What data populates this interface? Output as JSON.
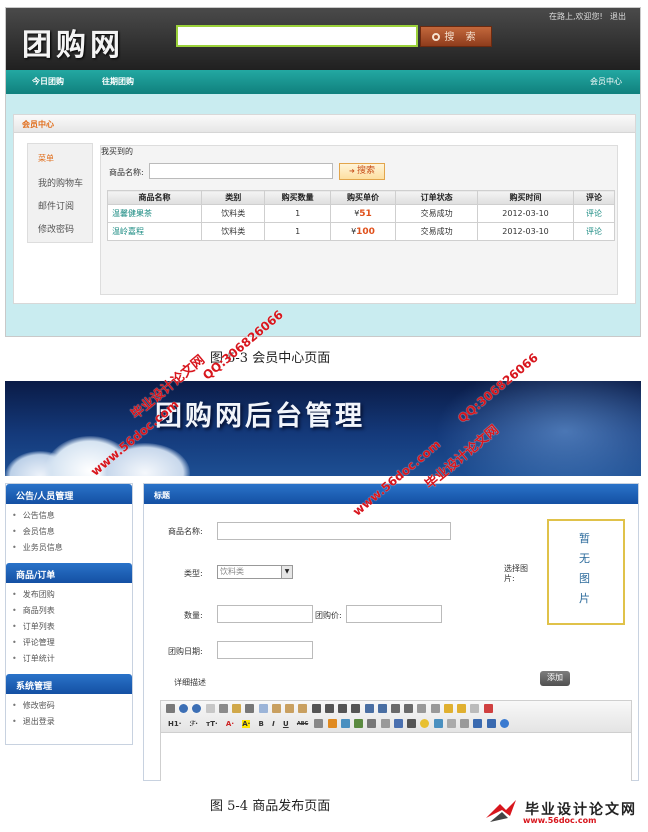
{
  "figure1": {
    "logo": "团购网",
    "search_button": "搜 索",
    "user_greeting": "在路上,欢迎您!",
    "logout": "退出",
    "nav": [
      "今日团购",
      "往期团购",
      "会员中心"
    ],
    "panel_title": "会员中心",
    "menu": [
      "菜单",
      "我的购物车",
      "邮件订阅",
      "修改密码"
    ],
    "section_title": "我买到的",
    "filter_label": "商品名称:",
    "filter_button": "搜索",
    "orders": {
      "headers": [
        "商品名称",
        "类别",
        "购买数量",
        "购买单价",
        "订单状态",
        "购买时间",
        "评论"
      ],
      "rows": [
        {
          "name": "温馨健果茶",
          "category": "饮料类",
          "qty": "1",
          "currency": "¥",
          "price": "51",
          "status": "交易成功",
          "date": "2012-03-10",
          "action": "评论"
        },
        {
          "name": "温岭嘉程",
          "category": "饮料类",
          "qty": "1",
          "currency": "¥",
          "price": "100",
          "status": "交易成功",
          "date": "2012-03-10",
          "action": "评论"
        }
      ]
    },
    "caption": "图 5-3 会员中心页面"
  },
  "figure2": {
    "banner_title": "团购网后台管理",
    "sidebar": [
      {
        "title": "公告/人员管理",
        "items": [
          "公告信息",
          "会员信息",
          "业务员信息"
        ]
      },
      {
        "title": "商品/订单",
        "items": [
          "发布团购",
          "商品列表",
          "订单列表",
          "评论管理",
          "订单统计"
        ]
      },
      {
        "title": "系统管理",
        "items": [
          "修改密码",
          "退出登录"
        ]
      }
    ],
    "form_title": "标题",
    "labels": {
      "product_name": "商品名称:",
      "type": "类型:",
      "quantity": "数量:",
      "group_price": "团购价:",
      "group_date": "团购日期:",
      "description": "详细描述",
      "select_image": "选择图片:"
    },
    "category_value": "饮料类",
    "no_image": "暂无图片",
    "add_button": "添加",
    "toolbar_row2_labels": [
      "H1·",
      "ℱ·",
      "тT·",
      "A·",
      "A·",
      "B",
      "I",
      "U",
      "ABC"
    ],
    "caption": "图 5-4 商品发布页面"
  },
  "watermarks": [
    "毕业设计论文网",
    "www.56doc.com",
    "QQ:306826066",
    "QQ:306826066",
    "www.56doc.com",
    "毕业设计论文网"
  ],
  "footer_logo": {
    "text": "毕业设计论文网",
    "url": "www.56doc.com"
  },
  "colors": {
    "teal_nav": "#1a948f",
    "orange_accent": "#e06d1b",
    "blue_header": "#1d5fb5",
    "watermark_red": "#d8161d"
  }
}
